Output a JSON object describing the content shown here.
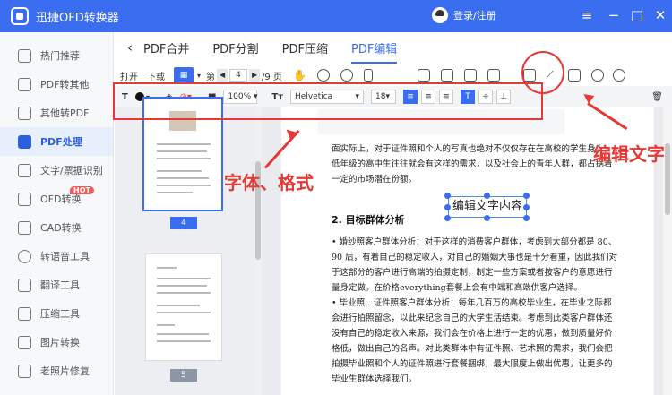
{
  "app": {
    "title": "迅捷OFD转换器",
    "login": "登录/注册"
  },
  "window": {
    "menu_icon": "menu-icon",
    "min_icon": "minimize-icon",
    "max_icon": "maximize-icon",
    "close_icon": "close-icon"
  },
  "sidebar": {
    "items": [
      {
        "label": "热门推荐",
        "icon": "thumbs-up-icon"
      },
      {
        "label": "PDF转其他",
        "icon": "pdf-icon"
      },
      {
        "label": "其他转PDF",
        "icon": "convert-icon"
      },
      {
        "label": "PDF处理",
        "icon": "pdf-process-icon",
        "active": true
      },
      {
        "label": "文字/票据识别",
        "icon": "ocr-icon"
      },
      {
        "label": "OFD转换",
        "icon": "ofd-icon",
        "badge": "HOT"
      },
      {
        "label": "CAD转换",
        "icon": "cad-icon"
      },
      {
        "label": "转语音工具",
        "icon": "voice-icon"
      },
      {
        "label": "翻译工具",
        "icon": "translate-icon"
      },
      {
        "label": "压缩工具",
        "icon": "compress-icon"
      },
      {
        "label": "图片转换",
        "icon": "image-icon"
      },
      {
        "label": "老照片修复",
        "icon": "photo-repair-icon"
      }
    ]
  },
  "tabs": {
    "back": "‹",
    "items": [
      "PDF合并",
      "PDF分割",
      "PDF压缩",
      "PDF编辑"
    ],
    "active": 3
  },
  "toolbar1": {
    "open": "打开",
    "download": "下载",
    "page_prefix": "第",
    "page_current": "4",
    "page_total": "/9 页"
  },
  "toolbar2": {
    "zoom": "100%",
    "font": "Helvetica",
    "size": "18"
  },
  "annotations": {
    "font_format": "字体、格式",
    "edit_text": "编辑文字",
    "edit_box": "编辑文字内容"
  },
  "thumbnails": {
    "page4": "4",
    "page5": "5"
  },
  "document": {
    "para1": "面实际上，对于证件照和个人的写真也绝对不仅仅存在在高校的学生身上，低年级的高中生往往就会有这样的需求，以及社会上的青年人群，都占据着一定的市场潜在份额。",
    "heading": "2. 目标群体分析",
    "para2": "• 婚纱照客户群体分析：对于这样的消费客户群体，考虑到大部分都是 80、90 后，有着自己的稳定收入，对自己的婚姻大事也是十分看重，因此我们对于这部分的客户进行高端的拍摄定制，制定一些方案或者按客户的意愿进行量身定做。在价格everything套餐上会有中端和高端供客户选择。",
    "para3": "• 毕业照、证件照客户群体分析：每年几百万的高校毕业生，在毕业之际都会进行拍照留念，以此来纪念自己的大学生活结束。考虑到此类客户群体还没有自己的稳定收入来源，我们会在价格上进行一定的优惠，做到质量好价格低，做出自己的名声。对此类群体中有证件照、艺术照的需求，我们会把拍摄毕业照和个人的证件照进行套餐捆绑，最大限度上做出优惠，让更多的毕业生群体选择我们。"
  }
}
